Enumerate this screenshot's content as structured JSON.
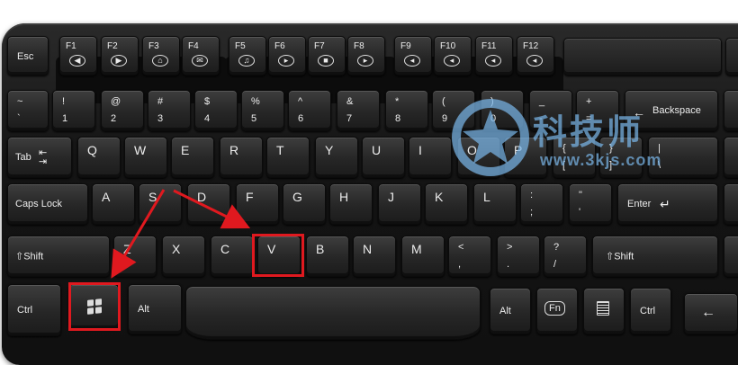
{
  "function_row": [
    "Esc",
    "F1",
    "F2",
    "F3",
    "F4",
    "F5",
    "F6",
    "F7",
    "F8",
    "F9",
    "F10",
    "F11",
    "F12"
  ],
  "number_row": [
    {
      "top": "~",
      "bot": "`"
    },
    {
      "top": "!",
      "bot": "1"
    },
    {
      "top": "@",
      "bot": "2"
    },
    {
      "top": "#",
      "bot": "3"
    },
    {
      "top": "$",
      "bot": "4"
    },
    {
      "top": "%",
      "bot": "5"
    },
    {
      "top": "^",
      "bot": "6"
    },
    {
      "top": "&",
      "bot": "7"
    },
    {
      "top": "*",
      "bot": "8"
    },
    {
      "top": "(",
      "bot": "9"
    },
    {
      "top": ")",
      "bot": "0"
    },
    {
      "top": "_",
      "bot": "-"
    },
    {
      "top": "+",
      "bot": "="
    }
  ],
  "backspace": "Backspace",
  "tab": "Tab",
  "qwerty_row": [
    "Q",
    "W",
    "E",
    "R",
    "T",
    "Y",
    "U",
    "I",
    "O",
    "P"
  ],
  "bracket_keys": [
    {
      "top": "{",
      "bot": "["
    },
    {
      "top": "}",
      "bot": "]"
    },
    {
      "top": "|",
      "bot": "\\"
    }
  ],
  "caps_lock": "Caps Lock",
  "home_row": [
    "A",
    "S",
    "D",
    "F",
    "G",
    "H",
    "J",
    "K",
    "L"
  ],
  "semicolon": {
    "top": ":",
    "bot": ";"
  },
  "quote": {
    "top": "\"",
    "bot": "'"
  },
  "enter": "Enter",
  "shift_left": "Shift",
  "bottom_letters": [
    "Z",
    "X",
    "C",
    "V",
    "B",
    "N",
    "M"
  ],
  "comma": {
    "top": "<",
    "bot": ","
  },
  "period": {
    "top": ">",
    "bot": "."
  },
  "slash": {
    "top": "?",
    "bot": "/"
  },
  "shift_right": "Shift",
  "ctrl_left": "Ctrl",
  "alt_left": "Alt",
  "alt_right": "Alt",
  "fn": "Fn",
  "ctrl_right": "Ctrl",
  "watermark": {
    "text": "科技师",
    "url": "www.3kjs.com"
  },
  "colors": {
    "highlight": "#e0191f",
    "keycap": "#262626",
    "watermark": "#78b4e6"
  },
  "icons": {
    "windows_key": "windows-logo-icon",
    "menu_key": "menu-icon",
    "arrow_left": "left-arrow-icon"
  }
}
